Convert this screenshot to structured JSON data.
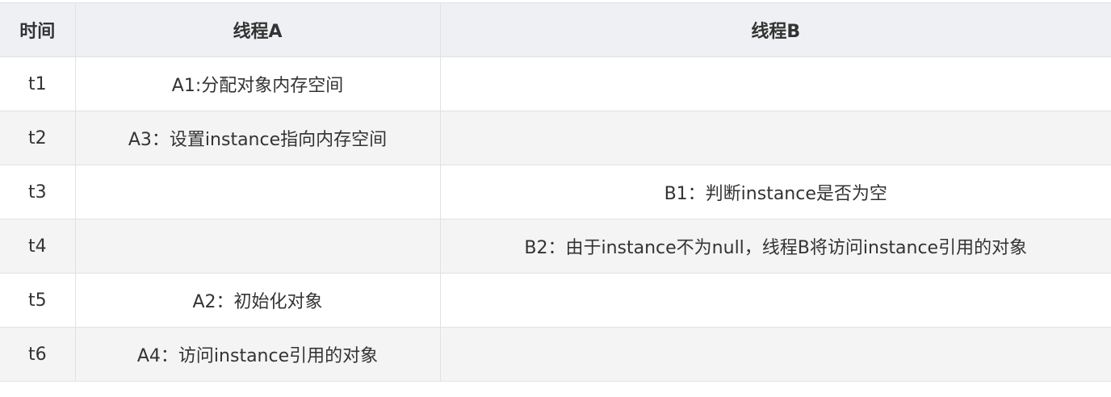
{
  "table": {
    "headers": [
      "时间",
      "线程A",
      "线程B"
    ],
    "rows": [
      {
        "time": "t1",
        "thread_a": "A1:分配对象内存空间",
        "thread_b": ""
      },
      {
        "time": "t2",
        "thread_a": "A3：设置instance指向内存空间",
        "thread_b": ""
      },
      {
        "time": "t3",
        "thread_a": "",
        "thread_b": "B1：判断instance是否为空"
      },
      {
        "time": "t4",
        "thread_a": "",
        "thread_b": "B2：由于instance不为null，线程B将访问instance引用的对象"
      },
      {
        "time": "t5",
        "thread_a": "A2：初始化对象",
        "thread_b": ""
      },
      {
        "time": "t6",
        "thread_a": "A4：访问instance引用的对象",
        "thread_b": ""
      }
    ]
  }
}
